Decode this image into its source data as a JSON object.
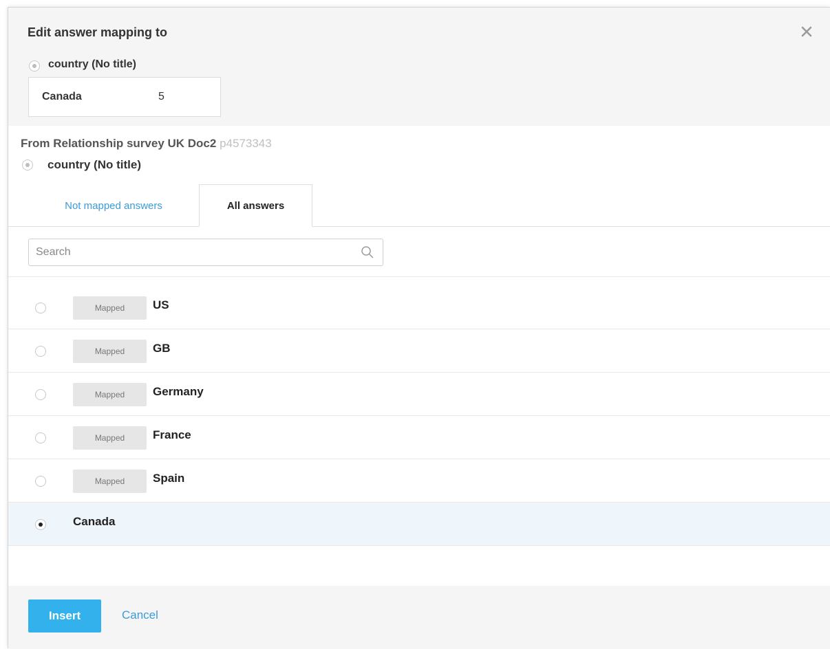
{
  "dialog": {
    "title": "Edit answer mapping to",
    "close_icon": "close-icon"
  },
  "target": {
    "question_label": "country (No title)",
    "answer_name": "Canada",
    "answer_code": "5"
  },
  "source": {
    "from_prefix": "From Relationship survey UK Doc2",
    "project_id": "p4573343",
    "question_label": "country (No title)"
  },
  "tabs": [
    {
      "label": "Not mapped answers",
      "active": false
    },
    {
      "label": "All answers",
      "active": true
    }
  ],
  "search": {
    "placeholder": "Search",
    "value": "",
    "icon": "search-icon"
  },
  "answers": [
    {
      "label": "US",
      "badge": "Mapped",
      "selected": false
    },
    {
      "label": "GB",
      "badge": "Mapped",
      "selected": false
    },
    {
      "label": "Germany",
      "badge": "Mapped",
      "selected": false
    },
    {
      "label": "France",
      "badge": "Mapped",
      "selected": false
    },
    {
      "label": "Spain",
      "badge": "Mapped",
      "selected": false
    },
    {
      "label": "Canada",
      "badge": "",
      "selected": true
    }
  ],
  "footer": {
    "insert_label": "Insert",
    "cancel_label": "Cancel"
  },
  "colors": {
    "accent": "#33b1ec",
    "link": "#3a9bd9",
    "selected_row": "#eef6fb"
  }
}
